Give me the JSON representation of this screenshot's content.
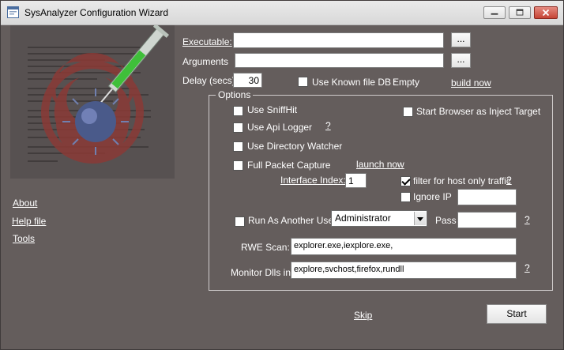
{
  "window": {
    "title": "SysAnalyzer Configuration Wizard"
  },
  "left_links": {
    "about": "About",
    "help": "Help file",
    "tools": "Tools"
  },
  "main": {
    "executable_label": "Executable:",
    "executable_value": "",
    "browse_label": "...",
    "arguments_label": "Arguments",
    "arguments_value": "",
    "delay_label": "Delay (secs)",
    "delay_value": "30",
    "use_known_file_db_label": "Use Known file DB :",
    "known_file_db_status": "Empty",
    "build_now_link": "build now"
  },
  "options": {
    "group_title": "Options",
    "use_sniffhit": {
      "label": "Use SniffHit",
      "checked": false
    },
    "start_browser": {
      "label": "Start Browser as Inject Target",
      "checked": false
    },
    "use_api_logger": {
      "label": "Use Api Logger",
      "checked": false
    },
    "help_mark": "?",
    "use_directory_watcher": {
      "label": "Use Directory Watcher",
      "checked": false
    },
    "full_packet_capture": {
      "label": "Full Packet Capture",
      "checked": false
    },
    "launch_now_link": "launch now",
    "interface_index_label": "Interface Index:",
    "interface_index_value": "1",
    "filter_host": {
      "label": "filter for host only traffic",
      "checked": true
    },
    "ignore_ip": {
      "label": "Ignore IP",
      "checked": false,
      "value": ""
    },
    "run_as_user": {
      "label": "Run As Another User",
      "checked": false,
      "selected": "Administrator"
    },
    "pass_label": "Pass",
    "pass_value": "",
    "rwe_scan_label": "RWE Scan:",
    "rwe_scan_value": "explorer.exe,iexplore.exe,",
    "monitor_dlls_label": "Monitor Dlls in:",
    "monitor_dlls_value": "explore,svchost,firefox,rundll"
  },
  "footer": {
    "skip_link": "Skip",
    "start_button": "Start"
  },
  "colors": {
    "background": "#645d5c",
    "biohazard": "#8a3a36",
    "virus": "#4a5a8a",
    "syringe_liquid": "#3fbf3a"
  },
  "icons": {
    "app": "app-window-icon",
    "minimize": "minimize-icon",
    "maximize": "maximize-icon",
    "close": "close-icon"
  }
}
